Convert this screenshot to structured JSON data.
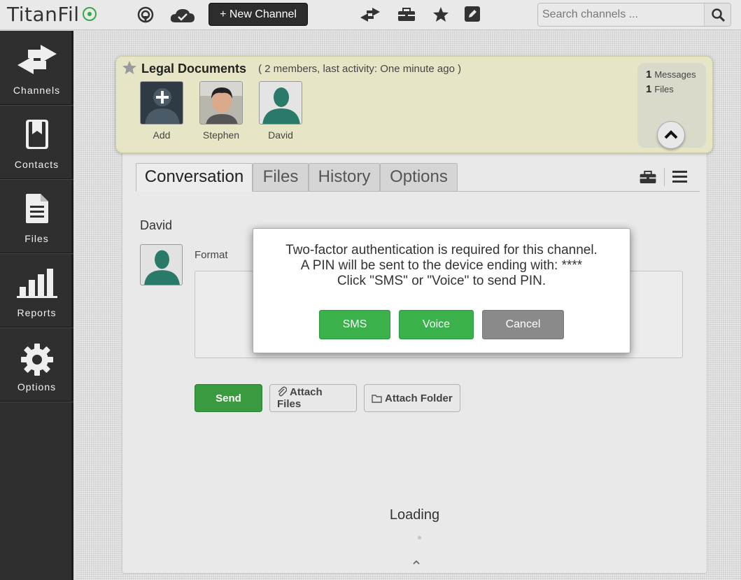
{
  "app": {
    "logo_text": "TitanFil",
    "new_channel_label": "+ New Channel",
    "search_placeholder": "Search channels ..."
  },
  "sidebar": {
    "items": [
      {
        "label": "Channels",
        "icon": "arrows-swap-icon"
      },
      {
        "label": "Contacts",
        "icon": "address-book-icon"
      },
      {
        "label": "Files",
        "icon": "file-icon"
      },
      {
        "label": "Reports",
        "icon": "bar-chart-icon"
      },
      {
        "label": "Options",
        "icon": "gear-icon"
      }
    ]
  },
  "channel": {
    "title": "Legal Documents",
    "meta": "( 2 members, last activity: One minute ago )",
    "members": [
      {
        "name": "Add"
      },
      {
        "name": "Stephen"
      },
      {
        "name": "David"
      }
    ],
    "stats": {
      "messages_count": "1",
      "messages_label": "Messages",
      "files_count": "1",
      "files_label": "Files"
    }
  },
  "tabs": [
    {
      "label": "Conversation",
      "active": true
    },
    {
      "label": "Files",
      "active": false
    },
    {
      "label": "History",
      "active": false
    },
    {
      "label": "Options",
      "active": false
    }
  ],
  "compose": {
    "author": "David",
    "format_label": "Format",
    "send_label": "Send",
    "attach_files_label": "Attach Files",
    "attach_folder_label": "Attach Folder"
  },
  "loading_text": "Loading",
  "modal": {
    "line1": "Two-factor authentication is required for this channel.",
    "line2": "A PIN will be sent to the device ending with: ****",
    "line3": "Click \"SMS\" or \"Voice\" to send PIN.",
    "sms_label": "SMS",
    "voice_label": "Voice",
    "cancel_label": "Cancel"
  },
  "colors": {
    "accent_green": "#3ab14a",
    "sidebar_bg": "#2f2f2f",
    "header_card_bg": "#e6e6c6"
  }
}
